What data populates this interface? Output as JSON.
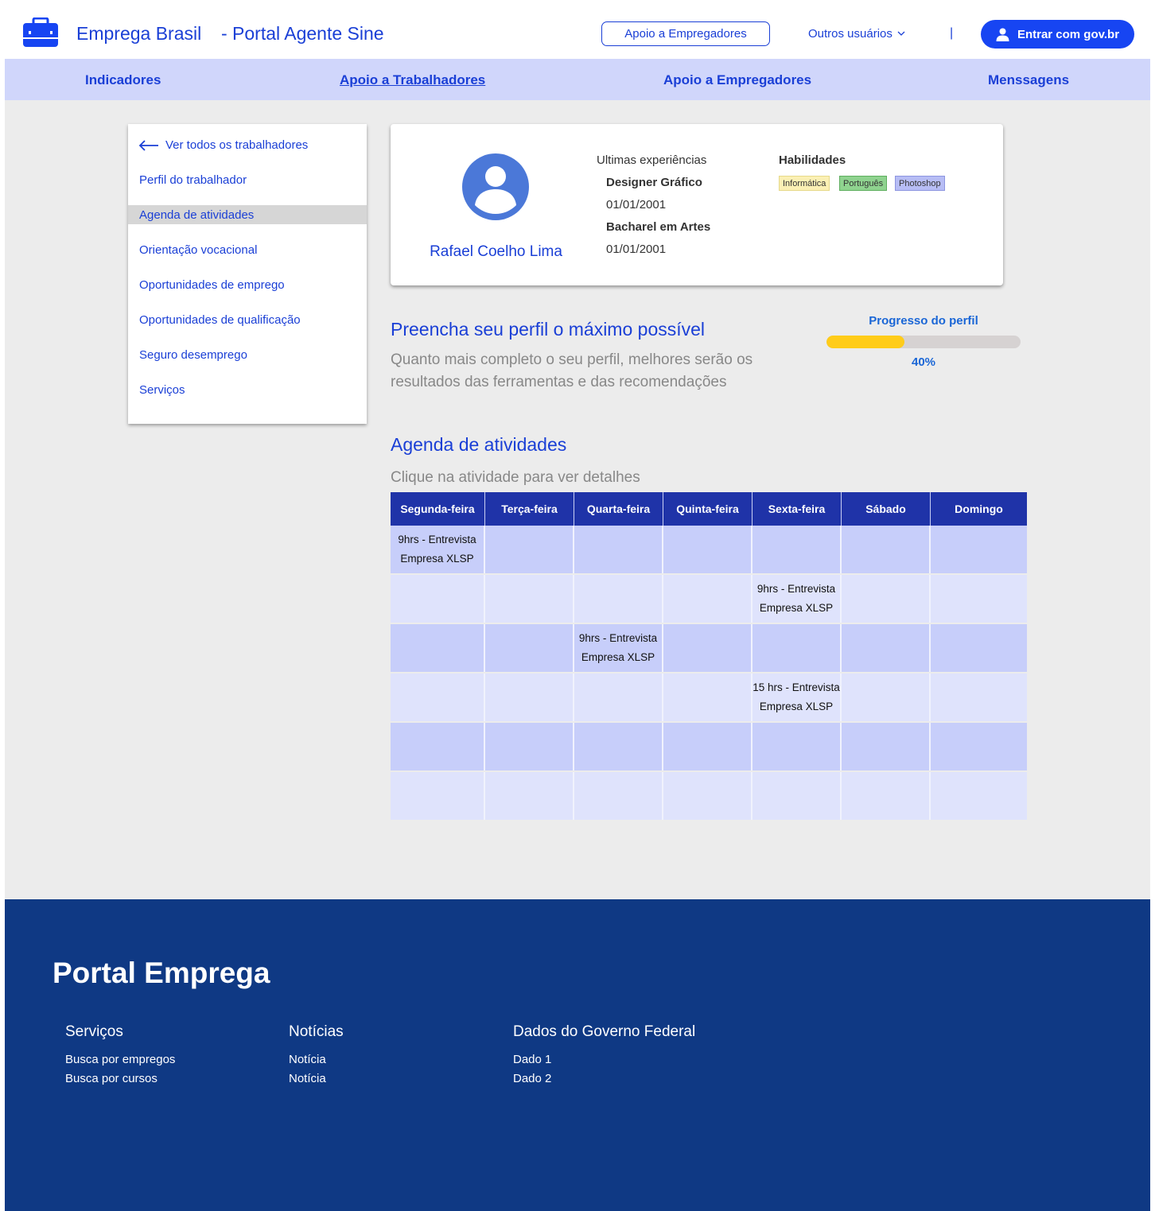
{
  "header": {
    "brand": "Emprega Brasil",
    "subtitle": "- Portal Agente Sine",
    "employer_button": "Apoio a Empregadores",
    "other_users": "Outros usuários",
    "separator": "|",
    "login_button": "Entrar com gov.br",
    "logo_icon": "briefcase-icon",
    "accent_color": "#1745f2"
  },
  "nav": {
    "items": [
      {
        "label": "Indicadores",
        "active": false
      },
      {
        "label": "Apoio a Trabalhadores",
        "active": true
      },
      {
        "label": "Apoio a Empregadores",
        "active": false
      },
      {
        "label": "Menssagens",
        "active": false
      }
    ]
  },
  "sidebar": {
    "back_label": "Ver todos os trabalhadores",
    "items": [
      {
        "label": "Perfil do trabalhador",
        "selected": false
      },
      {
        "label": "Agenda de atividades",
        "selected": true
      },
      {
        "label": "Orientação vocacional",
        "selected": false
      },
      {
        "label": "Oportunidades de emprego",
        "selected": false
      },
      {
        "label": "Oportunidades de qualificação",
        "selected": false
      },
      {
        "label": "Seguro desemprego",
        "selected": false
      },
      {
        "label": "Serviços",
        "selected": false
      }
    ]
  },
  "profile": {
    "name": "Rafael Coelho Lima",
    "experience_title": "Ultimas experiências",
    "experiences": [
      {
        "title": "Designer Gráfico",
        "date": "01/01/2001"
      },
      {
        "title": "Bacharel em Artes",
        "date": "01/01/2001"
      }
    ],
    "skills_title": "Habilidades",
    "skills": [
      {
        "label": "Informática",
        "bg": "#fbf0b4",
        "border": "#e6d98a"
      },
      {
        "label": "Português",
        "bg": "#8fd38f",
        "border": "#5fae5f"
      },
      {
        "label": "Photoshop",
        "bg": "#b7bdf5",
        "border": "#8d95e0"
      }
    ]
  },
  "completion": {
    "title": "Preencha seu perfil o máximo possível",
    "description": "Quanto mais completo o seu perfil, melhores serão os resultados das ferramentas e das recomendações",
    "progress_label": "Progresso do perfil",
    "progress_value": 40,
    "progress_text": "40%"
  },
  "agenda": {
    "title": "Agenda de atividades",
    "hint": "Clique na atividade para ver detalhes",
    "days": [
      "Segunda-feira",
      "Terça-feira",
      "Quarta-feira",
      "Quinta-feira",
      "Sexta-feira",
      "Sábado",
      "Domingo"
    ],
    "rows": [
      [
        [
          "9hrs - Entrevista",
          "Empresa XLSP"
        ],
        [],
        [],
        [],
        [],
        [],
        []
      ],
      [
        [],
        [],
        [],
        [],
        [
          "9hrs - Entrevista",
          "Empresa XLSP"
        ],
        [],
        []
      ],
      [
        [],
        [],
        [
          "9hrs - Entrevista",
          "Empresa XLSP"
        ],
        [],
        [],
        [],
        []
      ],
      [
        [],
        [],
        [],
        [],
        [
          "15 hrs - Entrevista",
          "Empresa XLSP"
        ],
        [],
        []
      ],
      [
        [],
        [],
        [],
        [],
        [],
        [],
        []
      ],
      [
        [],
        [],
        [],
        [],
        [],
        [],
        []
      ]
    ]
  },
  "footer": {
    "title": "Portal Emprega",
    "columns": [
      {
        "heading": "Serviços",
        "links": [
          "Busca por empregos",
          "Busca por cursos"
        ]
      },
      {
        "heading": "Notícias",
        "links": [
          "Notícia",
          "Notícia"
        ]
      },
      {
        "heading": "Dados do Governo Federal",
        "links": [
          "Dado 1",
          "Dado 2"
        ]
      }
    ]
  }
}
